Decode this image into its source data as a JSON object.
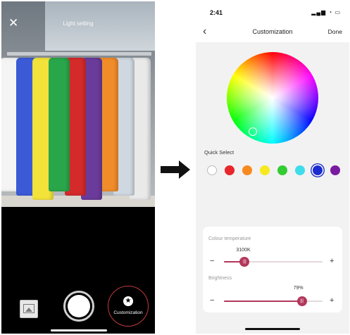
{
  "camera_screen": {
    "title": "Light setting",
    "close_glyph": "✕",
    "customization_label": "Customization",
    "customization_icon": "star-icon",
    "shirt_colors": [
      "#f4f4f4",
      "#3b5bd6",
      "#f2e23a",
      "#2aa64a",
      "#d42a2a",
      "#6a3b9a",
      "#f08c2a",
      "#cfd8e0",
      "#e9e9e9"
    ]
  },
  "settings_screen": {
    "status_time": "2:41",
    "status_icons": "▂▄▆ ◔ ▭",
    "back_glyph": "‹",
    "title": "Customization",
    "done_label": "Done",
    "quick_select_label": "Quick Select",
    "quick_colors": [
      "#ffffff",
      "#e8262b",
      "#f7891f",
      "#f7e91f",
      "#33cc33",
      "#3fdcec",
      "#1b2ccf",
      "#7a1aa1"
    ],
    "selected_index": 6,
    "colour_temperature": {
      "label": "Colour temperature",
      "value_text": "3100K",
      "fraction": 0.21
    },
    "brightness": {
      "label": "Brightness",
      "value_text": "79%",
      "fraction": 0.79
    },
    "minus_glyph": "−",
    "plus_glyph": "+",
    "thumb_glyph": "|||"
  }
}
